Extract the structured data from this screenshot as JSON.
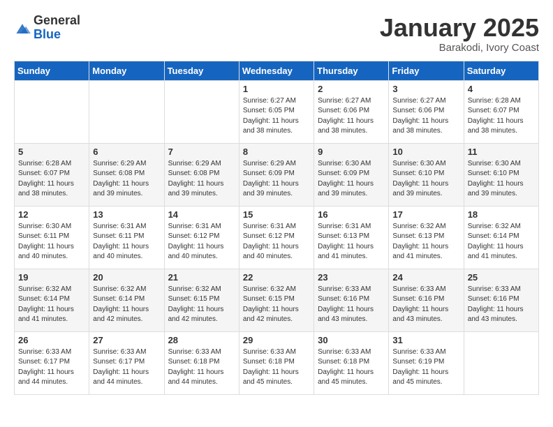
{
  "header": {
    "logo": {
      "general": "General",
      "blue": "Blue"
    },
    "title": "January 2025",
    "location": "Barakodi, Ivory Coast"
  },
  "weekdays": [
    "Sunday",
    "Monday",
    "Tuesday",
    "Wednesday",
    "Thursday",
    "Friday",
    "Saturday"
  ],
  "weeks": [
    [
      {
        "day": "",
        "info": ""
      },
      {
        "day": "",
        "info": ""
      },
      {
        "day": "",
        "info": ""
      },
      {
        "day": "1",
        "info": "Sunrise: 6:27 AM\nSunset: 6:05 PM\nDaylight: 11 hours\nand 38 minutes."
      },
      {
        "day": "2",
        "info": "Sunrise: 6:27 AM\nSunset: 6:06 PM\nDaylight: 11 hours\nand 38 minutes."
      },
      {
        "day": "3",
        "info": "Sunrise: 6:27 AM\nSunset: 6:06 PM\nDaylight: 11 hours\nand 38 minutes."
      },
      {
        "day": "4",
        "info": "Sunrise: 6:28 AM\nSunset: 6:07 PM\nDaylight: 11 hours\nand 38 minutes."
      }
    ],
    [
      {
        "day": "5",
        "info": "Sunrise: 6:28 AM\nSunset: 6:07 PM\nDaylight: 11 hours\nand 38 minutes."
      },
      {
        "day": "6",
        "info": "Sunrise: 6:29 AM\nSunset: 6:08 PM\nDaylight: 11 hours\nand 39 minutes."
      },
      {
        "day": "7",
        "info": "Sunrise: 6:29 AM\nSunset: 6:08 PM\nDaylight: 11 hours\nand 39 minutes."
      },
      {
        "day": "8",
        "info": "Sunrise: 6:29 AM\nSunset: 6:09 PM\nDaylight: 11 hours\nand 39 minutes."
      },
      {
        "day": "9",
        "info": "Sunrise: 6:30 AM\nSunset: 6:09 PM\nDaylight: 11 hours\nand 39 minutes."
      },
      {
        "day": "10",
        "info": "Sunrise: 6:30 AM\nSunset: 6:10 PM\nDaylight: 11 hours\nand 39 minutes."
      },
      {
        "day": "11",
        "info": "Sunrise: 6:30 AM\nSunset: 6:10 PM\nDaylight: 11 hours\nand 39 minutes."
      }
    ],
    [
      {
        "day": "12",
        "info": "Sunrise: 6:30 AM\nSunset: 6:11 PM\nDaylight: 11 hours\nand 40 minutes."
      },
      {
        "day": "13",
        "info": "Sunrise: 6:31 AM\nSunset: 6:11 PM\nDaylight: 11 hours\nand 40 minutes."
      },
      {
        "day": "14",
        "info": "Sunrise: 6:31 AM\nSunset: 6:12 PM\nDaylight: 11 hours\nand 40 minutes."
      },
      {
        "day": "15",
        "info": "Sunrise: 6:31 AM\nSunset: 6:12 PM\nDaylight: 11 hours\nand 40 minutes."
      },
      {
        "day": "16",
        "info": "Sunrise: 6:31 AM\nSunset: 6:13 PM\nDaylight: 11 hours\nand 41 minutes."
      },
      {
        "day": "17",
        "info": "Sunrise: 6:32 AM\nSunset: 6:13 PM\nDaylight: 11 hours\nand 41 minutes."
      },
      {
        "day": "18",
        "info": "Sunrise: 6:32 AM\nSunset: 6:14 PM\nDaylight: 11 hours\nand 41 minutes."
      }
    ],
    [
      {
        "day": "19",
        "info": "Sunrise: 6:32 AM\nSunset: 6:14 PM\nDaylight: 11 hours\nand 41 minutes."
      },
      {
        "day": "20",
        "info": "Sunrise: 6:32 AM\nSunset: 6:14 PM\nDaylight: 11 hours\nand 42 minutes."
      },
      {
        "day": "21",
        "info": "Sunrise: 6:32 AM\nSunset: 6:15 PM\nDaylight: 11 hours\nand 42 minutes."
      },
      {
        "day": "22",
        "info": "Sunrise: 6:32 AM\nSunset: 6:15 PM\nDaylight: 11 hours\nand 42 minutes."
      },
      {
        "day": "23",
        "info": "Sunrise: 6:33 AM\nSunset: 6:16 PM\nDaylight: 11 hours\nand 43 minutes."
      },
      {
        "day": "24",
        "info": "Sunrise: 6:33 AM\nSunset: 6:16 PM\nDaylight: 11 hours\nand 43 minutes."
      },
      {
        "day": "25",
        "info": "Sunrise: 6:33 AM\nSunset: 6:16 PM\nDaylight: 11 hours\nand 43 minutes."
      }
    ],
    [
      {
        "day": "26",
        "info": "Sunrise: 6:33 AM\nSunset: 6:17 PM\nDaylight: 11 hours\nand 44 minutes."
      },
      {
        "day": "27",
        "info": "Sunrise: 6:33 AM\nSunset: 6:17 PM\nDaylight: 11 hours\nand 44 minutes."
      },
      {
        "day": "28",
        "info": "Sunrise: 6:33 AM\nSunset: 6:18 PM\nDaylight: 11 hours\nand 44 minutes."
      },
      {
        "day": "29",
        "info": "Sunrise: 6:33 AM\nSunset: 6:18 PM\nDaylight: 11 hours\nand 45 minutes."
      },
      {
        "day": "30",
        "info": "Sunrise: 6:33 AM\nSunset: 6:18 PM\nDaylight: 11 hours\nand 45 minutes."
      },
      {
        "day": "31",
        "info": "Sunrise: 6:33 AM\nSunset: 6:19 PM\nDaylight: 11 hours\nand 45 minutes."
      },
      {
        "day": "",
        "info": ""
      }
    ]
  ]
}
